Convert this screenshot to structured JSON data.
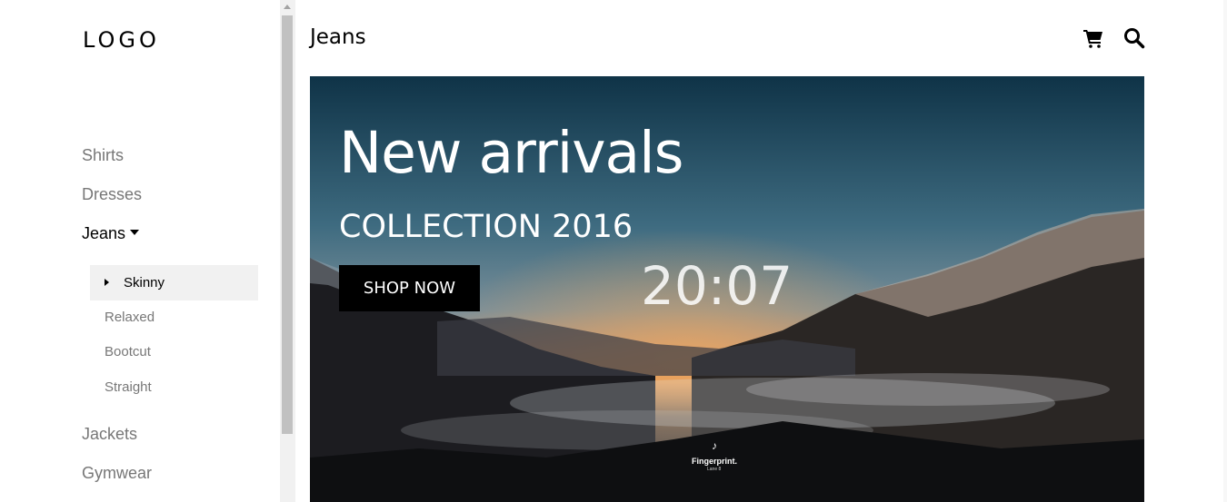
{
  "sidebar": {
    "logo": "LOGO",
    "items": [
      {
        "label": "Shirts"
      },
      {
        "label": "Dresses"
      },
      {
        "label": "Jeans"
      },
      {
        "label": "Jackets"
      },
      {
        "label": "Gymwear"
      }
    ],
    "subitems": [
      {
        "label": "Skinny"
      },
      {
        "label": "Relaxed"
      },
      {
        "label": "Bootcut"
      },
      {
        "label": "Straight"
      }
    ]
  },
  "header": {
    "title": "Jeans",
    "icons": [
      "shopping-cart-icon",
      "search-icon"
    ]
  },
  "hero": {
    "title": "New arrivals",
    "subtitle": "COLLECTION 2016",
    "button_label": "SHOP NOW",
    "clock": "20:07",
    "watermark_brand": "Fingerprint.",
    "watermark_sub": "Lane 8"
  }
}
